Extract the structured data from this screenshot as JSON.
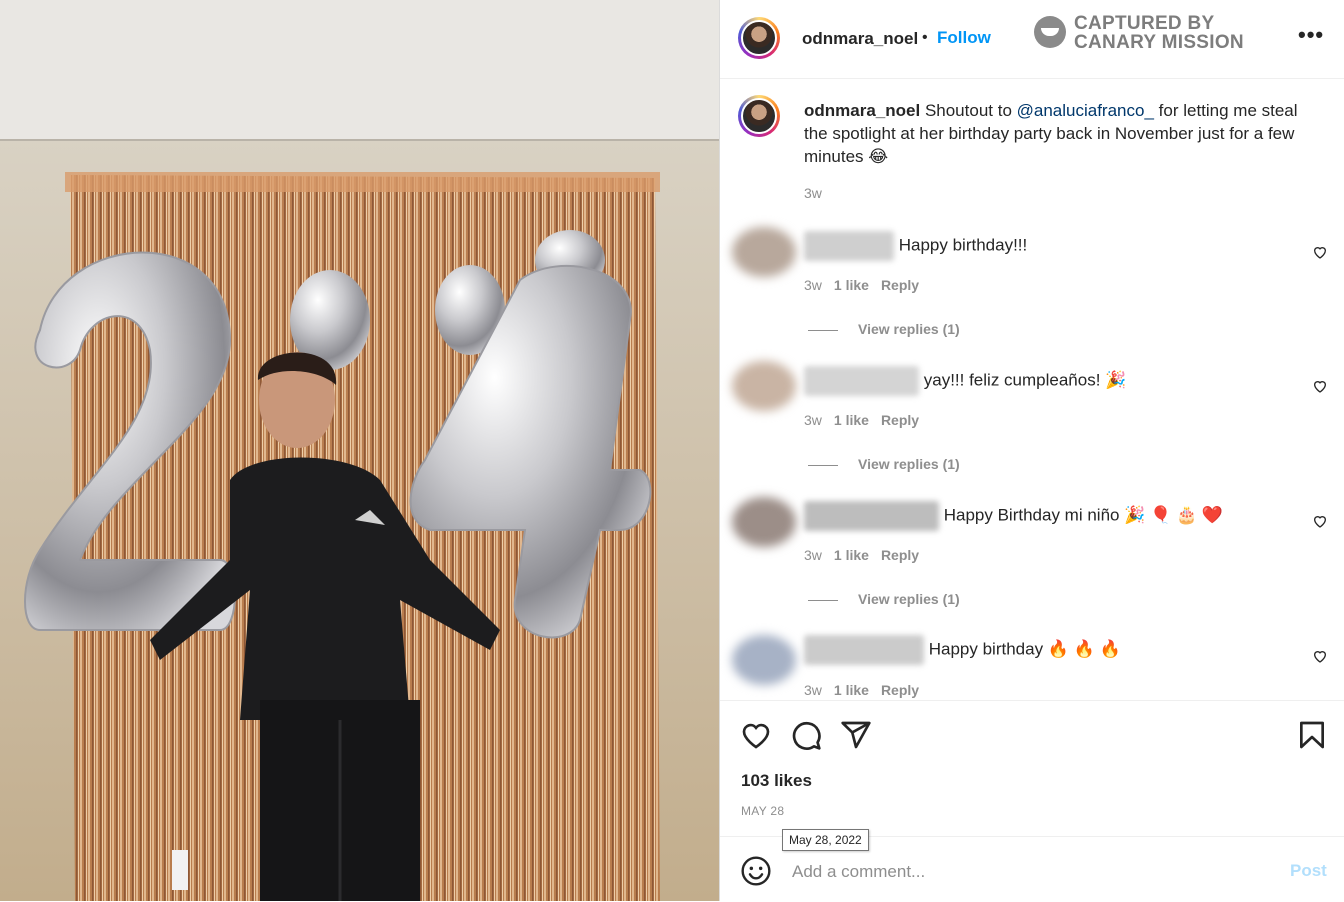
{
  "post": {
    "username": "odnmara_noel",
    "follow_label": "Follow",
    "separator": "•",
    "more_label": "•••",
    "watermark_line1": "CAPTURED BY",
    "watermark_line2": "CANARY MISSION",
    "photo_letters": "24",
    "caption": {
      "username": "odnmara_noel",
      "text_before": "Shoutout to ",
      "mention": "@analuciafranco_",
      "text_after": " for letting me steal the spotlight at her birthday party back in November just for a few minutes 😂",
      "age": "3w"
    },
    "comments": [
      {
        "name_visible": "",
        "text": "Happy birthday!!!",
        "age": "3w",
        "likes": "1 like",
        "reply": "Reply",
        "view_replies": "View replies (1)",
        "avatar_color": "#b8a89c"
      },
      {
        "name_visible": "r.ellsssaaaaan",
        "text": " yay!!! feliz cumpleaños! 🎉",
        "age": "3w",
        "likes": "1 like",
        "reply": "Reply",
        "view_replies": "View replies (1)",
        "avatar_color": "#c9b4a4"
      },
      {
        "name_visible": "3",
        "text": " Happy Birthday mi niño 🎉 🎈 🎂 ❤️",
        "age": "3w",
        "likes": "1 like",
        "reply": "Reply",
        "view_replies": "View replies (1)",
        "avatar_color": "#9c8e88"
      },
      {
        "name_visible": "y",
        "text": " Happy birthday 🔥 🔥 🔥",
        "age": "3w",
        "likes": "1 like",
        "reply": "Reply",
        "view_replies": "",
        "avatar_color": "#a7b2c6"
      }
    ],
    "likes": "103 likes",
    "date": "MAY 28",
    "date_tooltip": "May 28, 2022",
    "add_comment_placeholder": "Add a comment...",
    "post_label": "Post",
    "icons": [
      "heart-icon",
      "comment-icon",
      "share-icon",
      "bookmark-icon",
      "emoji-icon",
      "more-icon"
    ],
    "colors": {
      "accent": "#0095f6",
      "post_disabled": "#b2dffc",
      "muted": "#8e8e8e"
    }
  }
}
